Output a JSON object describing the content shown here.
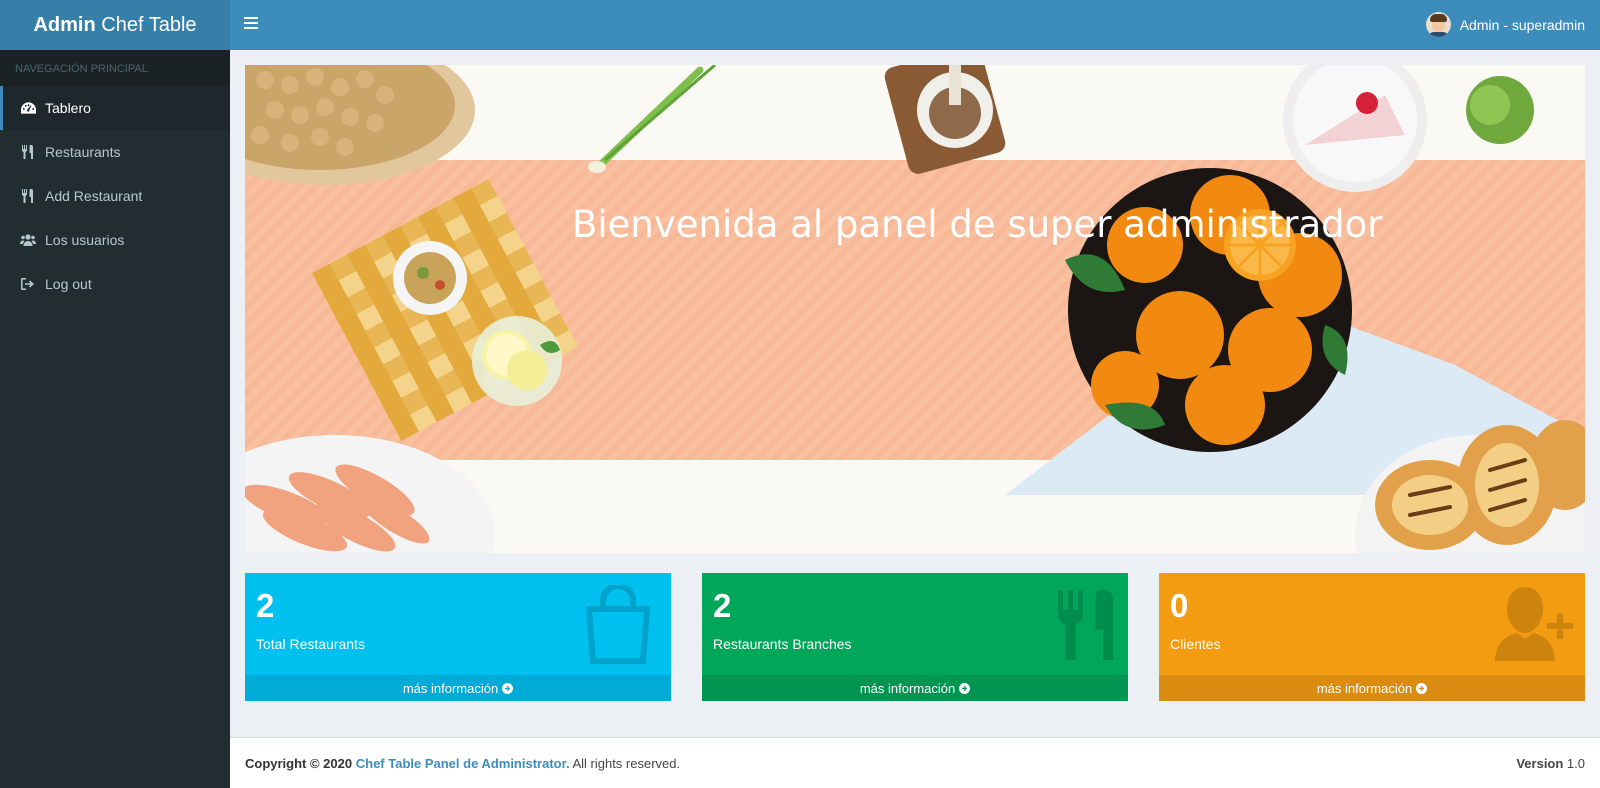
{
  "logo": {
    "bold": "Admin",
    "rest": " Chef Table"
  },
  "sidebar": {
    "header": "NAVEGACIÓN PRINCIPAL",
    "items": [
      {
        "label": "Tablero",
        "icon": "dashboard-icon",
        "active": true
      },
      {
        "label": "Restaurants",
        "icon": "cutlery-icon"
      },
      {
        "label": "Add Restaurant",
        "icon": "cutlery-icon"
      },
      {
        "label": "Los usuarios",
        "icon": "users-icon"
      },
      {
        "label": "Log out",
        "icon": "sign-out-icon"
      }
    ]
  },
  "navbar": {
    "user_name": "Admin - superadmin"
  },
  "banner": {
    "title": "Bienvenida al panel de super administrador"
  },
  "boxes": [
    {
      "value": "2",
      "label": "Total Restaurants",
      "link": "más información",
      "color": "#00c0ef",
      "footer_color": "#00acd6",
      "icon": "shopping-bag-icon"
    },
    {
      "value": "2",
      "label": "Restaurants Branches",
      "link": "más información",
      "color": "#00a65a",
      "footer_color": "#009551",
      "icon": "cutlery-icon"
    },
    {
      "value": "0",
      "label": "Clientes",
      "link": "más información",
      "color": "#f39c12",
      "footer_color": "#da8c10",
      "icon": "user-plus-icon"
    }
  ],
  "footer": {
    "copyright": "Copyright © 2020",
    "link": "Chef Table Panel de Administrator.",
    "rights": " All rights reserved.",
    "version_label": "Version",
    "version": " 1.0"
  }
}
